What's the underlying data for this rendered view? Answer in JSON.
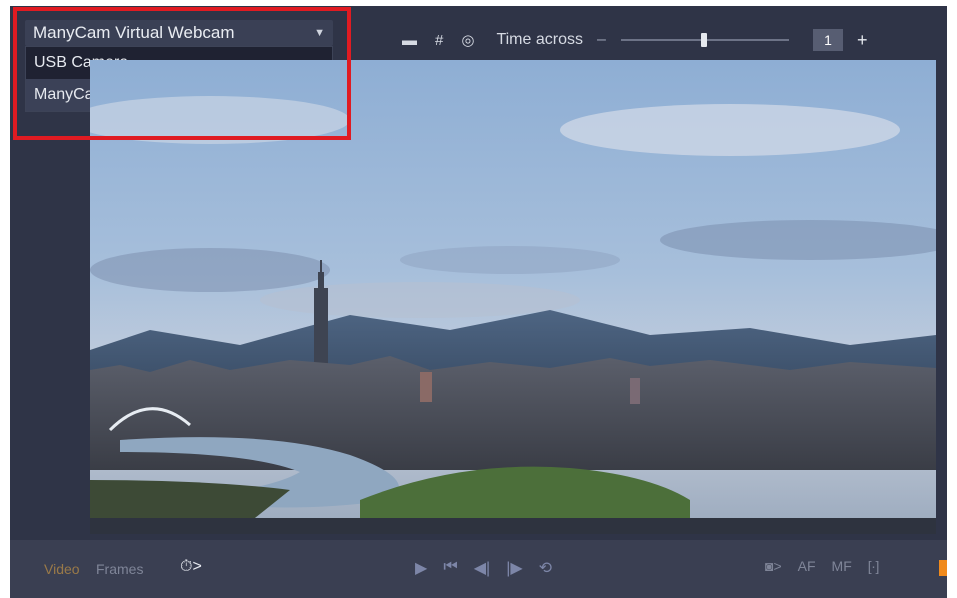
{
  "source": {
    "selected": "ManyCam Virtual Webcam",
    "caret_icon": "chevron-down-icon",
    "options": [
      "USB Camera",
      "ManyCam Virtual Webcam"
    ]
  },
  "toolbar": {
    "line_icon": "line-icon",
    "grid_icon": "grid-icon",
    "target_icon": "target-icon",
    "time_label": "Time across",
    "time_value": "1",
    "minus": "–",
    "plus": "+"
  },
  "bottom": {
    "video_tab": "Video",
    "frames_tab": "Frames",
    "timer_label": "⏱>",
    "controls": [
      "▶",
      "⏮",
      "◀|",
      "|▶",
      "⟲"
    ],
    "camera_label": "◙>",
    "af": "AF",
    "mf": "MF",
    "bracket": "[∙]"
  },
  "colors": {
    "highlight": "#e01b22",
    "accent": "#d9a042",
    "orange": "#f08a1c"
  }
}
